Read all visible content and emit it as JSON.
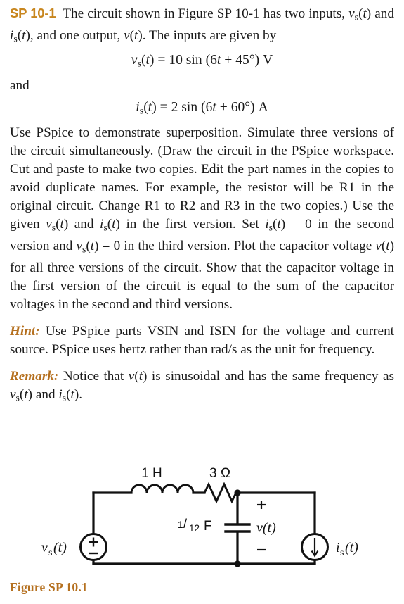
{
  "problem": {
    "id": "SP 10-1",
    "id_color": "#c8861e",
    "intro_line1": "The circuit shown in Figure SP 10-1 has two inputs,",
    "intro_line2_pre": "and",
    "intro_line2_post": ", and one output,",
    "intro_line2_end": ". The inputs are given by",
    "equation_1": "vₛ(t) = 10 sin (6t + 45°) V",
    "and_label": "and",
    "equation_2": "iₛ(t) = 2 sin (6t + 60°) A",
    "body_text": "Use PSpice to demonstrate superposition. Simulate three versions of the circuit simultaneously. (Draw the circuit in the PSpice workspace. Cut and paste to make two copies. Edit the part names in the copies to avoid duplicate names. For example, the resistor will be R1 in the original circuit. Change R1 to R2 and R3 in the two copies.) Use the given vₛ(t) and iₛ(t) in the first version. Set iₛ(t) = 0 in the second version and vₛ(t) = 0 in the third version. Plot the capacitor voltage v(t) for all three versions of the circuit. Show that the capacitor voltage in the first version of the circuit is equal to the sum of the capacitor voltages in the second and third versions.",
    "hint_label": "Hint:",
    "hint_text": "Use PSpice parts VSIN and ISIN for the voltage and current source. PSpice uses hertz rather than rad/s as the unit for frequency.",
    "remark_label": "Remark:",
    "remark_text": "Notice that v(t) is sinusoidal and has the same frequency as vₛ(t) and iₛ(t).",
    "accent_color": "#b5701f"
  },
  "figure": {
    "caption": "Figure SP 10.1",
    "caption_color": "#b5701f",
    "components": {
      "inductor_label": "1 H",
      "resistor_label": "3 Ω",
      "capacitor_value": "1",
      "capacitor_denominator": "12",
      "capacitor_unit": "F",
      "output_label": "v(t)",
      "output_plus": "+",
      "output_minus": "−",
      "voltage_source_label": "vₛ(t)",
      "voltage_source_plus": "+",
      "voltage_source_minus": "−",
      "current_source_label": "iₛ(t)",
      "current_direction": "down"
    }
  }
}
